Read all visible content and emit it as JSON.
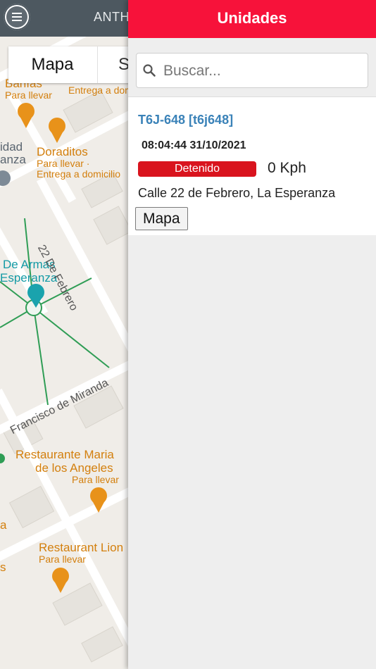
{
  "topbar": {
    "title_partial": "ANTH"
  },
  "tabs": {
    "map_label": "Mapa",
    "second_partial": "S"
  },
  "map": {
    "places": [
      {
        "name": "Banías",
        "sub": "Para llevar"
      },
      {
        "name": "Entrega a dom"
      },
      {
        "name": "Doraditos",
        "sub1": "Para llevar ·",
        "sub2": "Entrega a domicilio"
      },
      {
        "name": "idad",
        "name2": "anza"
      },
      {
        "name": "De Armas",
        "name2": "Esperanza"
      },
      {
        "name": "Restaurante Maria",
        "name2": "de los Angeles",
        "sub": "Para llevar"
      },
      {
        "name": "Restaurant Lion",
        "sub": "Para llevar"
      },
      {
        "name": "a"
      },
      {
        "name": "s"
      }
    ],
    "streets": {
      "s1": "22 De Febrero",
      "s2": "Francisco de Miranda"
    }
  },
  "panel": {
    "title": "Unidades",
    "search_placeholder": "Buscar...",
    "unit": {
      "name": "T6J-648 [t6j648]",
      "timestamp": "08:04:44 31/10/2021",
      "status": "Detenido",
      "speed": "0 Kph",
      "address": "Calle 22 de Febrero, La Esperanza",
      "map_button": "Mapa"
    }
  },
  "colors": {
    "header_red": "#f7123a",
    "status_red": "#d9141e",
    "link_blue": "#3a82b8",
    "topbar_gray": "#4d5860"
  }
}
